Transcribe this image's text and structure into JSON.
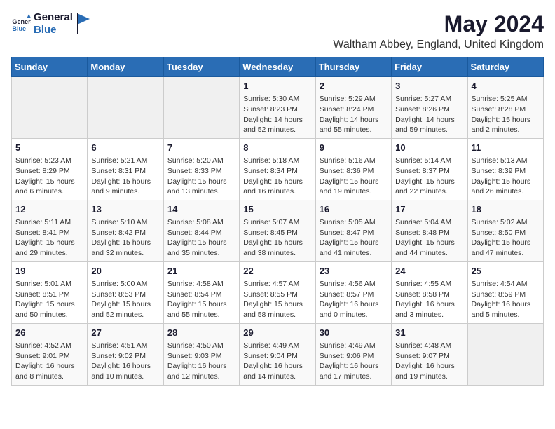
{
  "header": {
    "logo_general": "General",
    "logo_blue": "Blue",
    "title": "May 2024",
    "subtitle": "Waltham Abbey, England, United Kingdom"
  },
  "weekdays": [
    "Sunday",
    "Monday",
    "Tuesday",
    "Wednesday",
    "Thursday",
    "Friday",
    "Saturday"
  ],
  "weeks": [
    [
      {
        "day": "",
        "info": ""
      },
      {
        "day": "",
        "info": ""
      },
      {
        "day": "",
        "info": ""
      },
      {
        "day": "1",
        "info": "Sunrise: 5:30 AM\nSunset: 8:23 PM\nDaylight: 14 hours\nand 52 minutes."
      },
      {
        "day": "2",
        "info": "Sunrise: 5:29 AM\nSunset: 8:24 PM\nDaylight: 14 hours\nand 55 minutes."
      },
      {
        "day": "3",
        "info": "Sunrise: 5:27 AM\nSunset: 8:26 PM\nDaylight: 14 hours\nand 59 minutes."
      },
      {
        "day": "4",
        "info": "Sunrise: 5:25 AM\nSunset: 8:28 PM\nDaylight: 15 hours\nand 2 minutes."
      }
    ],
    [
      {
        "day": "5",
        "info": "Sunrise: 5:23 AM\nSunset: 8:29 PM\nDaylight: 15 hours\nand 6 minutes."
      },
      {
        "day": "6",
        "info": "Sunrise: 5:21 AM\nSunset: 8:31 PM\nDaylight: 15 hours\nand 9 minutes."
      },
      {
        "day": "7",
        "info": "Sunrise: 5:20 AM\nSunset: 8:33 PM\nDaylight: 15 hours\nand 13 minutes."
      },
      {
        "day": "8",
        "info": "Sunrise: 5:18 AM\nSunset: 8:34 PM\nDaylight: 15 hours\nand 16 minutes."
      },
      {
        "day": "9",
        "info": "Sunrise: 5:16 AM\nSunset: 8:36 PM\nDaylight: 15 hours\nand 19 minutes."
      },
      {
        "day": "10",
        "info": "Sunrise: 5:14 AM\nSunset: 8:37 PM\nDaylight: 15 hours\nand 22 minutes."
      },
      {
        "day": "11",
        "info": "Sunrise: 5:13 AM\nSunset: 8:39 PM\nDaylight: 15 hours\nand 26 minutes."
      }
    ],
    [
      {
        "day": "12",
        "info": "Sunrise: 5:11 AM\nSunset: 8:41 PM\nDaylight: 15 hours\nand 29 minutes."
      },
      {
        "day": "13",
        "info": "Sunrise: 5:10 AM\nSunset: 8:42 PM\nDaylight: 15 hours\nand 32 minutes."
      },
      {
        "day": "14",
        "info": "Sunrise: 5:08 AM\nSunset: 8:44 PM\nDaylight: 15 hours\nand 35 minutes."
      },
      {
        "day": "15",
        "info": "Sunrise: 5:07 AM\nSunset: 8:45 PM\nDaylight: 15 hours\nand 38 minutes."
      },
      {
        "day": "16",
        "info": "Sunrise: 5:05 AM\nSunset: 8:47 PM\nDaylight: 15 hours\nand 41 minutes."
      },
      {
        "day": "17",
        "info": "Sunrise: 5:04 AM\nSunset: 8:48 PM\nDaylight: 15 hours\nand 44 minutes."
      },
      {
        "day": "18",
        "info": "Sunrise: 5:02 AM\nSunset: 8:50 PM\nDaylight: 15 hours\nand 47 minutes."
      }
    ],
    [
      {
        "day": "19",
        "info": "Sunrise: 5:01 AM\nSunset: 8:51 PM\nDaylight: 15 hours\nand 50 minutes."
      },
      {
        "day": "20",
        "info": "Sunrise: 5:00 AM\nSunset: 8:53 PM\nDaylight: 15 hours\nand 52 minutes."
      },
      {
        "day": "21",
        "info": "Sunrise: 4:58 AM\nSunset: 8:54 PM\nDaylight: 15 hours\nand 55 minutes."
      },
      {
        "day": "22",
        "info": "Sunrise: 4:57 AM\nSunset: 8:55 PM\nDaylight: 15 hours\nand 58 minutes."
      },
      {
        "day": "23",
        "info": "Sunrise: 4:56 AM\nSunset: 8:57 PM\nDaylight: 16 hours\nand 0 minutes."
      },
      {
        "day": "24",
        "info": "Sunrise: 4:55 AM\nSunset: 8:58 PM\nDaylight: 16 hours\nand 3 minutes."
      },
      {
        "day": "25",
        "info": "Sunrise: 4:54 AM\nSunset: 8:59 PM\nDaylight: 16 hours\nand 5 minutes."
      }
    ],
    [
      {
        "day": "26",
        "info": "Sunrise: 4:52 AM\nSunset: 9:01 PM\nDaylight: 16 hours\nand 8 minutes."
      },
      {
        "day": "27",
        "info": "Sunrise: 4:51 AM\nSunset: 9:02 PM\nDaylight: 16 hours\nand 10 minutes."
      },
      {
        "day": "28",
        "info": "Sunrise: 4:50 AM\nSunset: 9:03 PM\nDaylight: 16 hours\nand 12 minutes."
      },
      {
        "day": "29",
        "info": "Sunrise: 4:49 AM\nSunset: 9:04 PM\nDaylight: 16 hours\nand 14 minutes."
      },
      {
        "day": "30",
        "info": "Sunrise: 4:49 AM\nSunset: 9:06 PM\nDaylight: 16 hours\nand 17 minutes."
      },
      {
        "day": "31",
        "info": "Sunrise: 4:48 AM\nSunset: 9:07 PM\nDaylight: 16 hours\nand 19 minutes."
      },
      {
        "day": "",
        "info": ""
      }
    ]
  ]
}
